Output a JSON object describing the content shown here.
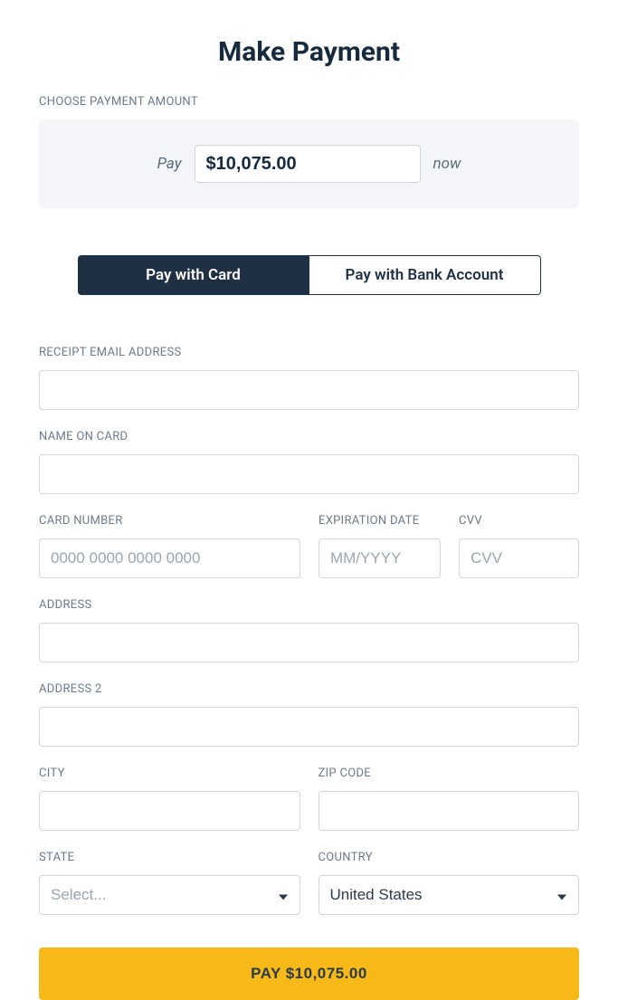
{
  "title": "Make Payment",
  "amount": {
    "label": "CHOOSE PAYMENT AMOUNT",
    "pay_prefix": "Pay",
    "value": "$10,075.00",
    "now_suffix": "now"
  },
  "tabs": {
    "card": "Pay with Card",
    "bank": "Pay with Bank Account"
  },
  "fields": {
    "email": {
      "label": "RECEIPT EMAIL ADDRESS"
    },
    "name": {
      "label": "NAME ON CARD"
    },
    "card_number": {
      "label": "CARD NUMBER",
      "placeholder": "0000 0000 0000 0000"
    },
    "expiration": {
      "label": "EXPIRATION DATE",
      "placeholder": "MM/YYYY"
    },
    "cvv": {
      "label": "CVV",
      "placeholder": "CVV"
    },
    "address": {
      "label": "ADDRESS"
    },
    "address2": {
      "label": "ADDRESS 2"
    },
    "city": {
      "label": "CITY"
    },
    "zip": {
      "label": "ZIP CODE"
    },
    "state": {
      "label": "STATE",
      "placeholder": "Select..."
    },
    "country": {
      "label": "COUNTRY",
      "value": "United States"
    }
  },
  "submit": "PAY $10,075.00"
}
